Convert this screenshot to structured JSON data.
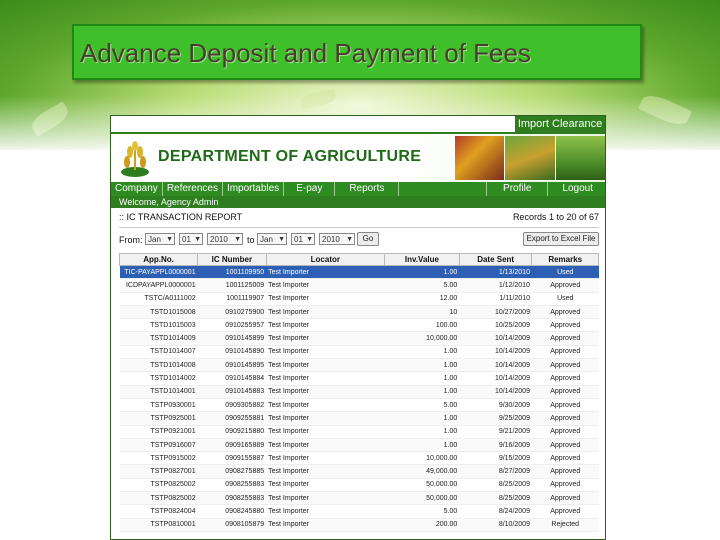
{
  "slide": {
    "title": "Advance Deposit and Payment of Fees"
  },
  "app": {
    "import_tab": "Import Clearance",
    "department_title": "DEPARTMENT OF AGRICULTURE",
    "nav": {
      "left": [
        "Company",
        "References",
        "Importables",
        "E-pay",
        "Reports"
      ],
      "right": [
        "Profile",
        "Logout"
      ]
    },
    "welcome": "Welcome, Agency Admin"
  },
  "report": {
    "title": ":: IC TRANSACTION REPORT",
    "range": "Records 1 to 20 of 67",
    "filter": {
      "from_label": "From:",
      "to_label": "to",
      "from_month": "Jan",
      "from_day": "01",
      "from_year": "2010",
      "to_month": "Jan",
      "to_day": "01",
      "to_year": "2010",
      "go_label": "Go",
      "export_label": "Export to Excel File"
    },
    "columns": [
      "App.No.",
      "IC Number",
      "Locator",
      "Inv.Value",
      "Date Sent",
      "Remarks"
    ],
    "rows": [
      {
        "app": "TIC-PAYAPPL0000001",
        "ic": "1001109950",
        "locator": "Test Importer",
        "inv": "1.00",
        "date": "1/13/2010",
        "remarks": "Used"
      },
      {
        "app": "ICDPAYAPPL0000001",
        "ic": "1001125009",
        "locator": "Test Importer",
        "inv": "5.00",
        "date": "1/12/2010",
        "remarks": "Approved"
      },
      {
        "app": "TSTC/A0111002",
        "ic": "1001119907",
        "locator": "Test Importer",
        "inv": "12.00",
        "date": "1/11/2010",
        "remarks": "Used"
      },
      {
        "app": "TSTD1015008",
        "ic": "0910275900",
        "locator": "Test Importer",
        "inv": "10",
        "date": "10/27/2009",
        "remarks": "Approved"
      },
      {
        "app": "TSTD1015003",
        "ic": "0910255957",
        "locator": "Test Importer",
        "inv": "100.00",
        "date": "10/25/2009",
        "remarks": "Approved"
      },
      {
        "app": "TSTD1014009",
        "ic": "0910145899",
        "locator": "Test Importer",
        "inv": "10,000.00",
        "date": "10/14/2009",
        "remarks": "Approved"
      },
      {
        "app": "TSTD1014007",
        "ic": "0910145890",
        "locator": "Test Importer",
        "inv": "1.00",
        "date": "10/14/2009",
        "remarks": "Approved"
      },
      {
        "app": "TSTD1014008",
        "ic": "0910145895",
        "locator": "Test Importer",
        "inv": "1.00",
        "date": "10/14/2009",
        "remarks": "Approved"
      },
      {
        "app": "TSTD1014002",
        "ic": "0910145884",
        "locator": "Test Importer",
        "inv": "1.00",
        "date": "10/14/2009",
        "remarks": "Approved"
      },
      {
        "app": "TSTD1014001",
        "ic": "0910145883",
        "locator": "Test Importer",
        "inv": "1.00",
        "date": "10/14/2009",
        "remarks": "Approved"
      },
      {
        "app": "TSTP0930001",
        "ic": "0909305882",
        "locator": "Test Importer",
        "inv": "5.00",
        "date": "9/30/2009",
        "remarks": "Approved"
      },
      {
        "app": "TSTP0925001",
        "ic": "0909255881",
        "locator": "Test Importer",
        "inv": "1.00",
        "date": "9/25/2009",
        "remarks": "Approved"
      },
      {
        "app": "TSTP0921001",
        "ic": "0909215880",
        "locator": "Test Importer",
        "inv": "1.00",
        "date": "9/21/2009",
        "remarks": "Approved"
      },
      {
        "app": "TSTP0916007",
        "ic": "0909165889",
        "locator": "Test Importer",
        "inv": "1.00",
        "date": "9/16/2009",
        "remarks": "Approved"
      },
      {
        "app": "TSTP0915002",
        "ic": "0909155887",
        "locator": "Test Importer",
        "inv": "10,000.00",
        "date": "9/15/2009",
        "remarks": "Approved"
      },
      {
        "app": "TSTP0827001",
        "ic": "0908275885",
        "locator": "Test Importer",
        "inv": "49,000.00",
        "date": "8/27/2009",
        "remarks": "Approved"
      },
      {
        "app": "TSTP0825002",
        "ic": "0908255883",
        "locator": "Test Importer",
        "inv": "50,000.00",
        "date": "8/25/2009",
        "remarks": "Approved"
      },
      {
        "app": "TSTP0825002",
        "ic": "0908255883",
        "locator": "Test Importer",
        "inv": "50,000.00",
        "date": "8/25/2009",
        "remarks": "Approved"
      },
      {
        "app": "TSTP0824004",
        "ic": "0908245880",
        "locator": "Test Importer",
        "inv": "5.00",
        "date": "8/24/2009",
        "remarks": "Approved"
      },
      {
        "app": "TSTP0810001",
        "ic": "0908105879",
        "locator": "Test Importer",
        "inv": "200.00",
        "date": "8/10/2009",
        "remarks": "Rejected"
      }
    ]
  },
  "colors": {
    "title_bar": "#3fbf2a",
    "nav_green": "#2e8b22",
    "dept_title": "#1e6a17",
    "selected_row": "#2d5fb4"
  }
}
